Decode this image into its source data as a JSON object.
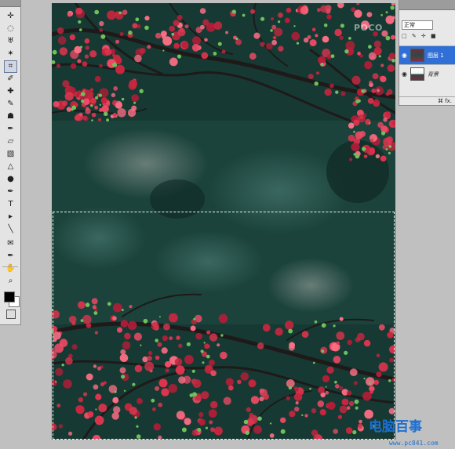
{
  "toolbox": {
    "tools": [
      {
        "name": "move-tool",
        "glyph": "✛"
      },
      {
        "name": "marquee-tool",
        "glyph": "◌"
      },
      {
        "name": "lasso-tool",
        "glyph": "♅"
      },
      {
        "name": "magic-wand-tool",
        "glyph": "✶"
      },
      {
        "name": "crop-tool",
        "glyph": "⌗"
      },
      {
        "name": "eyedropper-tool",
        "glyph": "✐"
      },
      {
        "name": "healing-brush-tool",
        "glyph": "✚"
      },
      {
        "name": "brush-tool",
        "glyph": "✎"
      },
      {
        "name": "clone-stamp-tool",
        "glyph": "☗"
      },
      {
        "name": "history-brush-tool",
        "glyph": "✒"
      },
      {
        "name": "eraser-tool",
        "glyph": "▱"
      },
      {
        "name": "gradient-tool",
        "glyph": "▧"
      },
      {
        "name": "blur-tool",
        "glyph": "△"
      },
      {
        "name": "dodge-tool",
        "glyph": "●"
      },
      {
        "name": "pen-tool",
        "glyph": "✒"
      },
      {
        "name": "type-tool",
        "glyph": "T"
      },
      {
        "name": "path-selection-tool",
        "glyph": "▸"
      },
      {
        "name": "shape-tool",
        "glyph": "╲"
      },
      {
        "name": "notes-tool",
        "glyph": "✉"
      },
      {
        "name": "eyedropper2-tool",
        "glyph": "✒"
      },
      {
        "name": "hand-tool",
        "glyph": "✋"
      },
      {
        "name": "zoom-tool",
        "glyph": "⌕"
      }
    ],
    "active_tool": "crop-tool",
    "foreground_color": "#000000",
    "background_color": "#ffffff"
  },
  "layers_panel": {
    "blend_mode": "正常",
    "lock_icons": "□ ✎ ✛ ■",
    "layers": [
      {
        "name": "图层 1",
        "selected": true
      },
      {
        "name": "背景",
        "selected": false
      }
    ],
    "footer_icons": "⌘ fx."
  },
  "watermarks": {
    "top": "POCO",
    "bottom": "电脑百事",
    "url": "www.pc841.com"
  },
  "colors": {
    "selection_highlight": "#2f6fd6",
    "blossom": "#e0344f",
    "foliage_dark": "#173831"
  }
}
